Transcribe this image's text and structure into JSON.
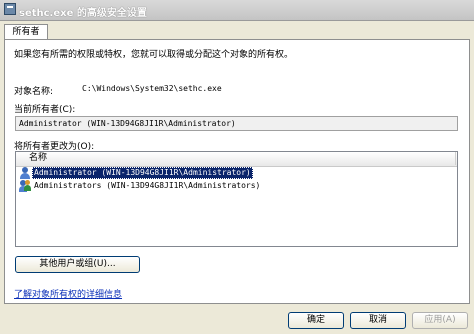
{
  "window": {
    "title": "sethc.exe 的高级安全设置"
  },
  "tabs": [
    {
      "label": "所有者"
    }
  ],
  "owner_tab": {
    "description": "如果您有所需的权限或特权，您就可以取得或分配这个对象的所有权。",
    "object_name_label": "对象名称:",
    "object_name_value": "C:\\Windows\\System32\\sethc.exe",
    "current_owner_label": "当前所有者(C):",
    "current_owner_value": "Administrator (WIN-13D94G8JI1R\\Administrator)",
    "change_owner_label": "将所有者更改为(O):",
    "list_header": "名称",
    "list_items": [
      {
        "label": "Administrator (WIN-13D94G8JI1R\\Administrator)",
        "icon": "user-icon",
        "selected": true
      },
      {
        "label": "Administrators (WIN-13D94G8JI1R\\Administrators)",
        "icon": "group-icon",
        "selected": false
      }
    ],
    "other_users_button": "其他用户或组(U)...",
    "learn_link": "了解对象所有权的详细信息"
  },
  "footer": {
    "ok_button": "确定",
    "cancel_button": "取消",
    "apply_button": "应用(A)"
  }
}
